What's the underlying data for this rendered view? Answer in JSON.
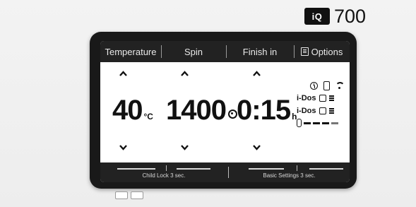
{
  "brand": {
    "logo": "iQ",
    "series": "700"
  },
  "header": {
    "temperature_label": "Temperature",
    "spin_label": "Spin",
    "finish_label": "Finish in",
    "options_label": "Options"
  },
  "values": {
    "temperature": "40",
    "temperature_unit": "°C",
    "spin": "1400",
    "finish_time": "0:15",
    "finish_unit": "h"
  },
  "status": {
    "idos1": "i-Dos",
    "idos2": "i-Dos"
  },
  "footer": {
    "left_label": "Child Lock 3 sec.",
    "right_label": "Basic Settings 3 sec."
  },
  "icons": {
    "up": "chevron-up-icon",
    "down": "chevron-down-icon",
    "timer": "timer-icon",
    "remote": "remote-start-icon",
    "wifi": "wifi-icon",
    "spin": "spin-icon",
    "options": "options-icon"
  }
}
